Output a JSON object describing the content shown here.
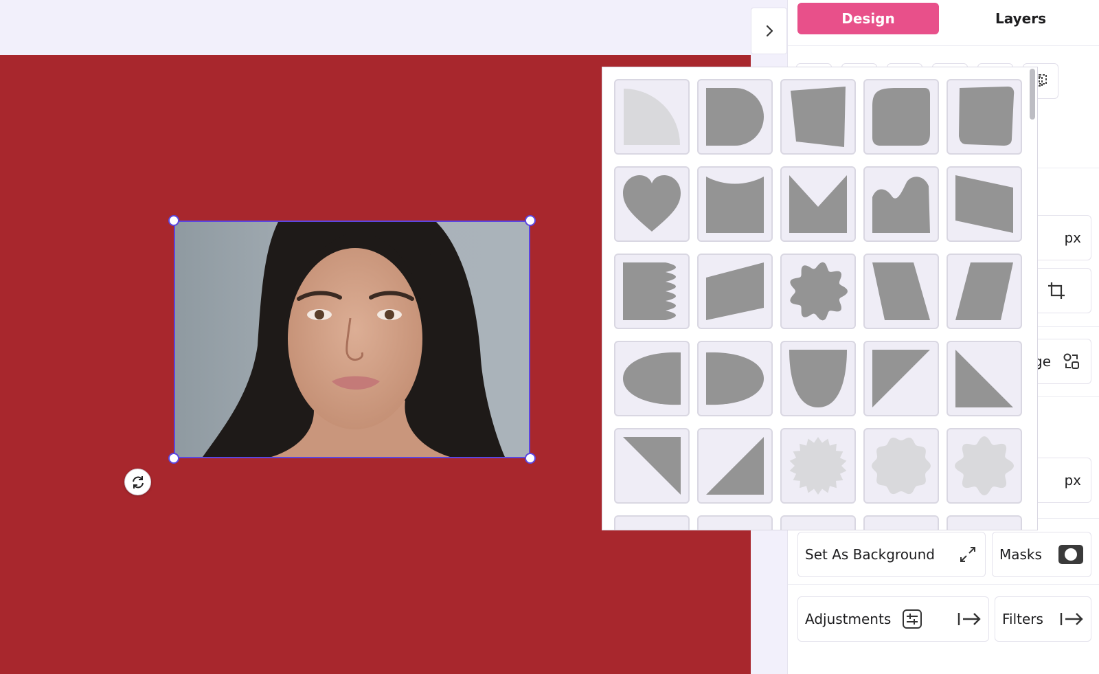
{
  "colors": {
    "canvas_bg": "#a8272d",
    "accent": "#e8508a",
    "selection": "#5b46e0",
    "shape_dark": "#949494",
    "shape_light": "#d9d9dc"
  },
  "tabs": {
    "design": "Design",
    "layers": "Layers"
  },
  "fields": {
    "unit_top": "px",
    "unit_bottom": "px",
    "replace_partial": "ge"
  },
  "actions": {
    "set_as_background": "Set As Background",
    "masks": "Masks",
    "adjustments": "Adjustments",
    "filters": "Filters"
  },
  "icons": {
    "collapse": "chevron-right-icon",
    "rotate": "rotate-icon",
    "crop": "crop-icon",
    "replace": "replace-icon",
    "expand": "expand-arrows-icon",
    "mask": "mask-icon",
    "adjust": "sliders-icon",
    "arrow": "arrow-to-right-icon"
  },
  "masks": [
    {
      "shape": "quarter-circle",
      "tone": "light"
    },
    {
      "shape": "d-shape",
      "tone": "dark"
    },
    {
      "shape": "trapezoid-tilt",
      "tone": "dark"
    },
    {
      "shape": "rounded-blob",
      "tone": "dark"
    },
    {
      "shape": "rounded-quad",
      "tone": "dark"
    },
    {
      "shape": "heart",
      "tone": "dark"
    },
    {
      "shape": "curved-top-rect",
      "tone": "dark"
    },
    {
      "shape": "notched-rect",
      "tone": "dark"
    },
    {
      "shape": "wavy-top-rect",
      "tone": "dark"
    },
    {
      "shape": "slant-rect",
      "tone": "dark"
    },
    {
      "shape": "scalloped-side",
      "tone": "dark"
    },
    {
      "shape": "slant-parallelogram",
      "tone": "dark"
    },
    {
      "shape": "flower",
      "tone": "dark"
    },
    {
      "shape": "trapezoid-left",
      "tone": "dark"
    },
    {
      "shape": "trapezoid-right",
      "tone": "dark"
    },
    {
      "shape": "half-ellipse-right",
      "tone": "dark"
    },
    {
      "shape": "half-ellipse-left",
      "tone": "dark"
    },
    {
      "shape": "shield",
      "tone": "dark"
    },
    {
      "shape": "triangle-top-left",
      "tone": "dark"
    },
    {
      "shape": "triangle-bottom-right",
      "tone": "dark"
    },
    {
      "shape": "triangle-top-right-corner",
      "tone": "dark"
    },
    {
      "shape": "triangle-bottom-left-corner",
      "tone": "dark"
    },
    {
      "shape": "starburst",
      "tone": "light"
    },
    {
      "shape": "badge",
      "tone": "light"
    },
    {
      "shape": "scallop-badge",
      "tone": "light"
    }
  ]
}
